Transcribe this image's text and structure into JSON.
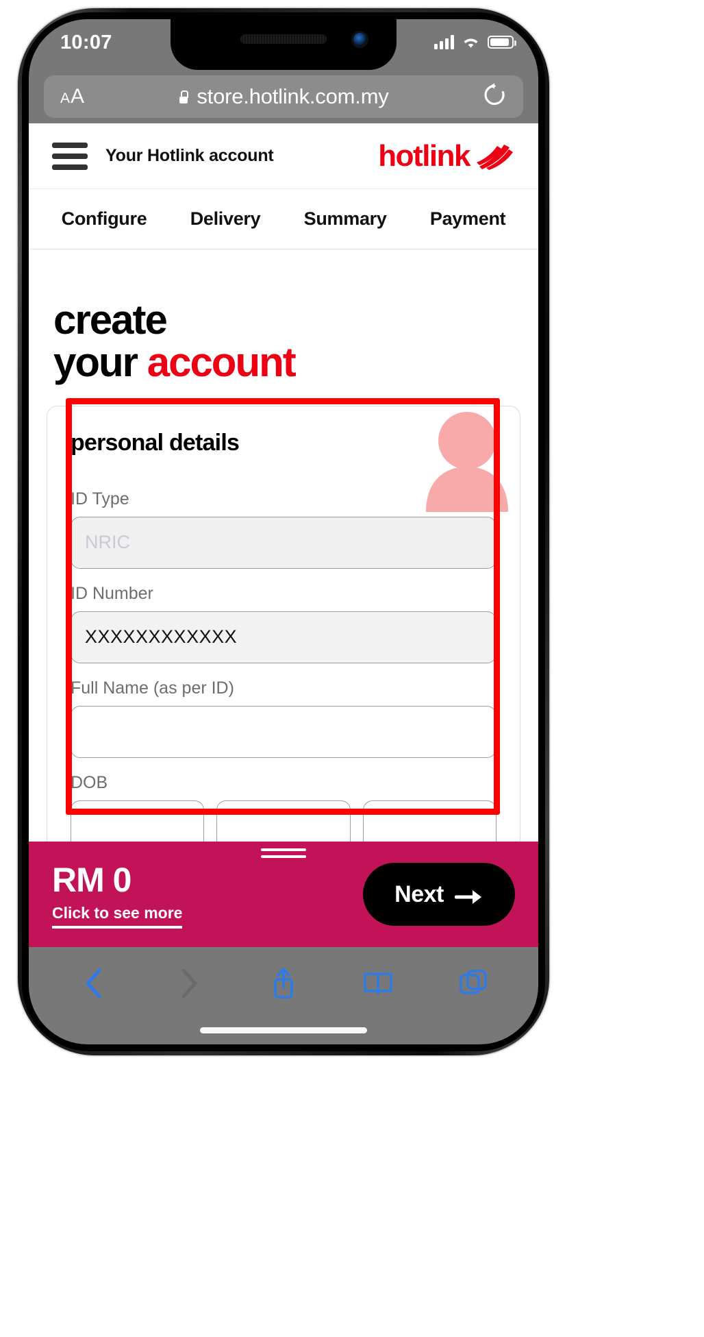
{
  "device": {
    "status_bar": {
      "time": "10:07",
      "signal_icon": "cellular-signal-icon",
      "wifi_icon": "wifi-icon",
      "battery_icon": "battery-icon",
      "battery_level_percent": 78
    }
  },
  "browser": {
    "name": "safari",
    "text_size_button": {
      "small_a": "A",
      "large_a": "A"
    },
    "secure_icon": "lock-icon",
    "url": "store.hotlink.com.my",
    "reload_icon": "reload-icon",
    "toolbar": [
      {
        "name": "back-button",
        "icon": "chevron-left-icon",
        "enabled": true
      },
      {
        "name": "forward-button",
        "icon": "chevron-right-icon",
        "enabled": false
      },
      {
        "name": "share-button",
        "icon": "share-icon",
        "enabled": true
      },
      {
        "name": "bookmarks-button",
        "icon": "book-icon",
        "enabled": true
      },
      {
        "name": "tabs-button",
        "icon": "tabs-icon",
        "enabled": true
      }
    ]
  },
  "site": {
    "header": {
      "menu_icon": "hamburger-menu-icon",
      "account_title": "Your Hotlink account",
      "brand_name": "hotlink",
      "brand_mark_icon": "hotlink-swoosh-icon"
    },
    "steps": [
      {
        "label": "Configure",
        "active": true
      },
      {
        "label": "Delivery",
        "active": false
      },
      {
        "label": "Summary",
        "active": false
      },
      {
        "label": "Payment",
        "active": false
      }
    ],
    "hero": {
      "line1": "create",
      "line2_plain": "your ",
      "line2_accent": "account"
    },
    "card": {
      "title": "personal details",
      "avatar_icon": "person-avatar-icon",
      "fields": [
        {
          "name": "id-type",
          "label": "ID Type",
          "value": "NRIC",
          "state": "disabled",
          "type": "select"
        },
        {
          "name": "id-number",
          "label": "ID Number",
          "value": "XXXXXXXXXXXX",
          "state": "filled",
          "type": "text"
        },
        {
          "name": "full-name",
          "label": "Full Name (as per ID)",
          "value": "",
          "state": "empty",
          "type": "text"
        },
        {
          "name": "dob",
          "label": "DOB",
          "value": "",
          "state": "empty",
          "type": "date-group"
        }
      ]
    }
  },
  "sticky_bar": {
    "grabber_icon": "drag-handle-icon",
    "price": "RM 0",
    "see_more_label": "Click to see more",
    "next_label": "Next",
    "next_icon": "arrow-right-icon"
  },
  "annotation": {
    "type": "highlight-rectangle",
    "color": "#ff0000"
  },
  "colors": {
    "brand_red": "#ee0014",
    "sticky_magenta": "#c31358",
    "annotation_red": "#ff0000",
    "safari_chrome": "#787878",
    "avatar_pink": "#f8aaaa"
  }
}
